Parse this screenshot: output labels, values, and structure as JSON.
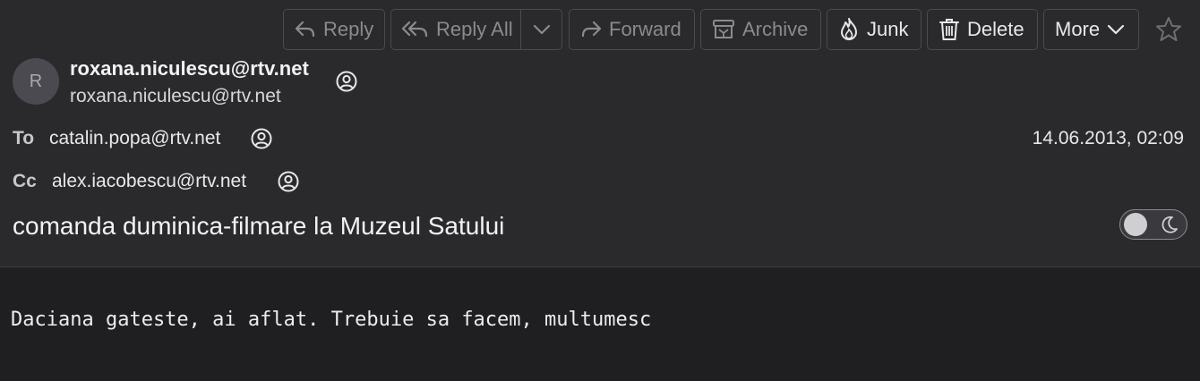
{
  "toolbar": {
    "reply": "Reply",
    "reply_all": "Reply All",
    "forward": "Forward",
    "archive": "Archive",
    "junk": "Junk",
    "delete": "Delete",
    "more": "More"
  },
  "message": {
    "avatar_initial": "R",
    "from_name": "roxana.niculescu@rtv.net",
    "from_address": "roxana.niculescu@rtv.net",
    "to_label": "To",
    "to": "catalin.popa@rtv.net",
    "cc_label": "Cc",
    "cc": "alex.iacobescu@rtv.net",
    "date": "14.06.2013, 02:09",
    "subject": "comanda duminica-filmare la Muzeul Satului",
    "body": "Daciana gateste, ai aflat. Trebuie sa facem, multumesc"
  },
  "theme": {
    "background": "#1f1f21",
    "header_background": "#2a2a2d",
    "button_border": "#4a4a4f",
    "disabled_text": "#8a8a8f"
  },
  "icons": [
    "reply-icon",
    "reply-all-icon",
    "chevron-down-icon",
    "forward-icon",
    "archive-icon",
    "junk-icon",
    "delete-icon",
    "star-icon",
    "contact-icon",
    "moon-icon"
  ]
}
